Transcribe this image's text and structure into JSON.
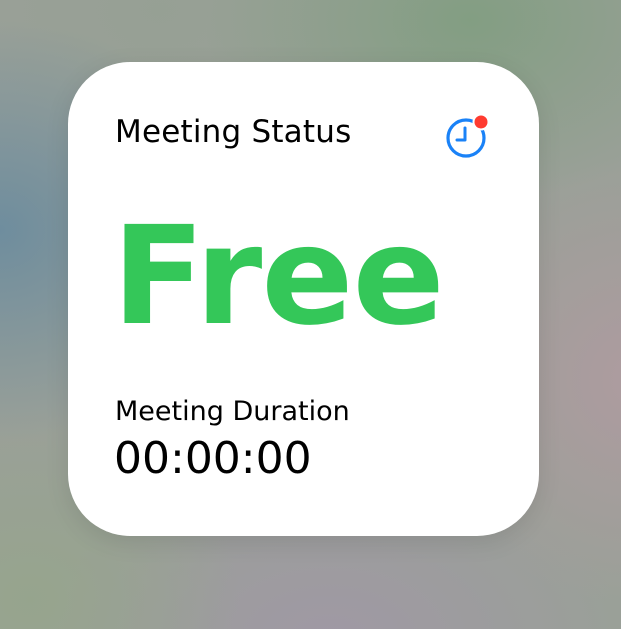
{
  "widget": {
    "title": "Meeting Status",
    "status": "Free",
    "status_color": "#34c759",
    "duration_label": "Meeting Duration",
    "duration_value": "00:00:00",
    "icon": {
      "name": "clock-icon",
      "color": "#1a82f7",
      "notification_dot_color": "#ff3b30"
    }
  }
}
